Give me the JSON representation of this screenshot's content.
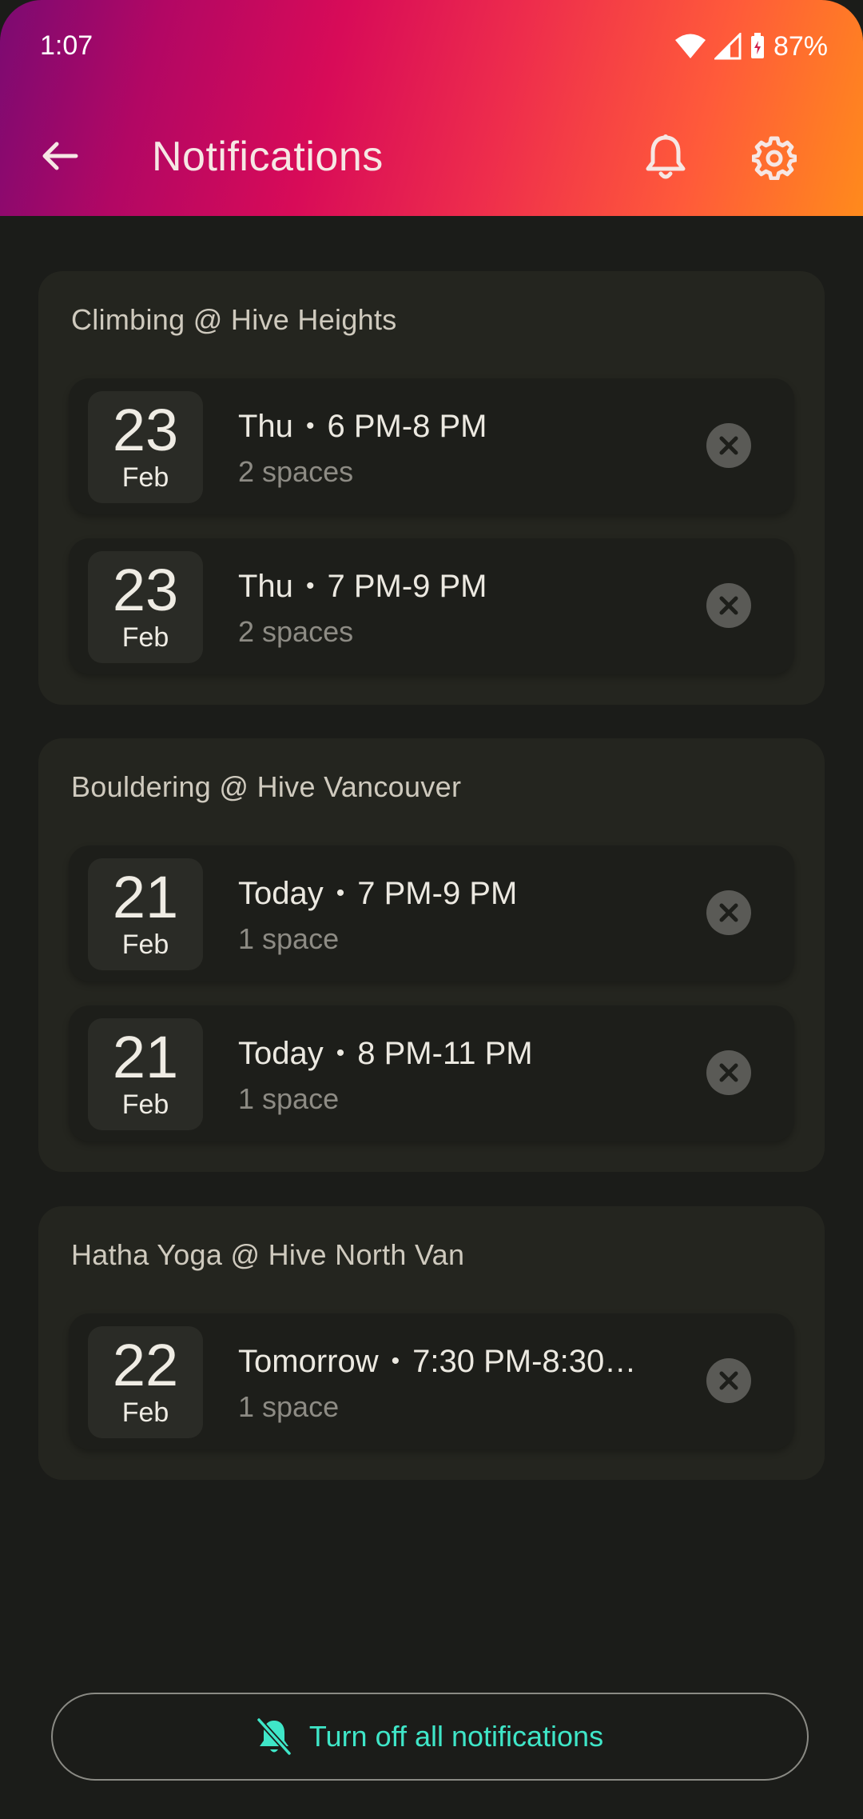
{
  "status_bar": {
    "time": "1:07",
    "battery": "87%"
  },
  "header": {
    "title": "Notifications",
    "icons": [
      "back-arrow-icon",
      "bell-icon",
      "gear-icon"
    ]
  },
  "groups": [
    {
      "title": "Climbing @ Hive Heights",
      "slots": [
        {
          "day": "23",
          "month": "Feb",
          "when": "Thu",
          "time": "6 PM-8 PM",
          "spaces": "2 spaces"
        },
        {
          "day": "23",
          "month": "Feb",
          "when": "Thu",
          "time": "7 PM-9 PM",
          "spaces": "2 spaces"
        }
      ]
    },
    {
      "title": "Bouldering @ Hive Vancouver",
      "slots": [
        {
          "day": "21",
          "month": "Feb",
          "when": "Today",
          "time": "7 PM-9 PM",
          "spaces": "1 space"
        },
        {
          "day": "21",
          "month": "Feb",
          "when": "Today",
          "time": "8 PM-11 PM",
          "spaces": "1 space"
        }
      ]
    },
    {
      "title": "Hatha Yoga @ Hive North Van",
      "slots": [
        {
          "day": "22",
          "month": "Feb",
          "when": "Tomorrow",
          "time": "7:30 PM-8:30…",
          "spaces": "1 space"
        }
      ]
    }
  ],
  "bottom_action": {
    "label": "Turn off all notifications",
    "icon": "bell-off-icon"
  },
  "colors": {
    "accent": "#3fe6c8",
    "background": "#1b1c19",
    "card": "#24251f"
  }
}
